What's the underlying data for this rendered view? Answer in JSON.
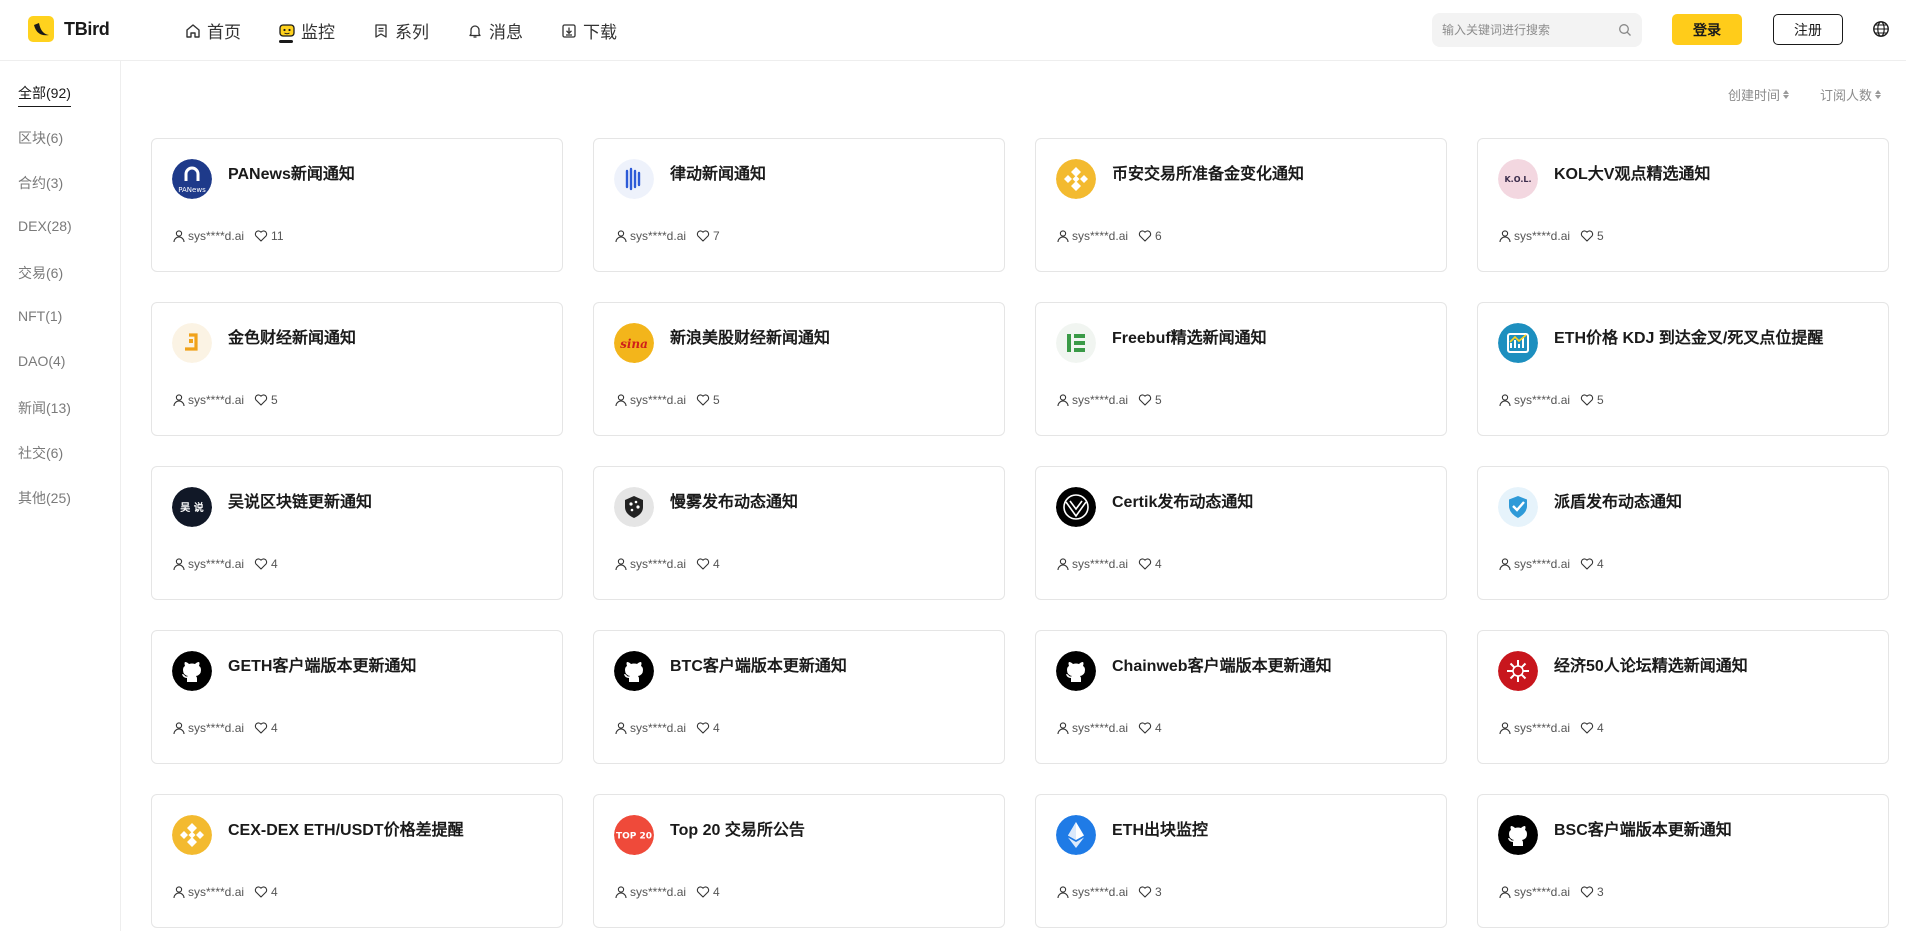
{
  "app": {
    "name": "TBird"
  },
  "nav": [
    {
      "label": "首页",
      "icon": "home-icon"
    },
    {
      "label": "监控",
      "icon": "monitor-icon",
      "active": true
    },
    {
      "label": "系列",
      "icon": "series-icon"
    },
    {
      "label": "消息",
      "icon": "bell-icon"
    },
    {
      "label": "下载",
      "icon": "download-icon"
    }
  ],
  "search": {
    "placeholder": "输入关键词进行搜索"
  },
  "auth": {
    "login": "登录",
    "register": "注册"
  },
  "categories": [
    "全部(92)",
    "区块(6)",
    "合约(3)",
    "DEX(28)",
    "交易(6)",
    "NFT(1)",
    "DAO(4)",
    "新闻(13)",
    "社交(6)",
    "其他(25)"
  ],
  "sort": {
    "created": "创建时间",
    "subscribers": "订阅人数"
  },
  "colors": {
    "accent": "#ffcc1a",
    "binance": "#f3ba2f",
    "github": "#000000"
  },
  "cards": [
    {
      "title": "PANews新闻通知",
      "author": "sys****d.ai",
      "likes": "11",
      "icon": "panews-icon",
      "icon_text": "PANews"
    },
    {
      "title": "律动新闻通知",
      "author": "sys****d.ai",
      "likes": "7",
      "icon": "blockbeats-icon"
    },
    {
      "title": "币安交易所准备金变化通知",
      "author": "sys****d.ai",
      "likes": "6",
      "icon": "binance-icon"
    },
    {
      "title": "KOL大V观点精选通知",
      "author": "sys****d.ai",
      "likes": "5",
      "icon": "kol-icon",
      "icon_text": "K.O.L."
    },
    {
      "title": "金色财经新闻通知",
      "author": "sys****d.ai",
      "likes": "5",
      "icon": "jinse-icon"
    },
    {
      "title": "新浪美股财经新闻通知",
      "author": "sys****d.ai",
      "likes": "5",
      "icon": "sina-icon",
      "icon_text": "sina"
    },
    {
      "title": "Freebuf精选新闻通知",
      "author": "sys****d.ai",
      "likes": "5",
      "icon": "freebuf-icon"
    },
    {
      "title": "ETH价格 KDJ 到达金叉/死叉点位提醒",
      "author": "sys****d.ai",
      "likes": "5",
      "icon": "chart-icon"
    },
    {
      "title": "吴说区块链更新通知",
      "author": "sys****d.ai",
      "likes": "4",
      "icon": "wushuo-icon",
      "icon_text": "吴 说"
    },
    {
      "title": "慢雾发布动态通知",
      "author": "sys****d.ai",
      "likes": "4",
      "icon": "slowmist-icon"
    },
    {
      "title": "Certik发布动态通知",
      "author": "sys****d.ai",
      "likes": "4",
      "icon": "certik-icon"
    },
    {
      "title": "派盾发布动态通知",
      "author": "sys****d.ai",
      "likes": "4",
      "icon": "peckshield-icon"
    },
    {
      "title": "GETH客户端版本更新通知",
      "author": "sys****d.ai",
      "likes": "4",
      "icon": "github-icon"
    },
    {
      "title": "BTC客户端版本更新通知",
      "author": "sys****d.ai",
      "likes": "4",
      "icon": "github-icon"
    },
    {
      "title": "Chainweb客户端版本更新通知",
      "author": "sys****d.ai",
      "likes": "4",
      "icon": "github-icon"
    },
    {
      "title": "经济50人论坛精选新闻通知",
      "author": "sys****d.ai",
      "likes": "4",
      "icon": "forum50-icon"
    },
    {
      "title": "CEX-DEX ETH/USDT价格差提醒",
      "author": "sys****d.ai",
      "likes": "4",
      "icon": "binance-icon"
    },
    {
      "title": "Top 20 交易所公告",
      "author": "sys****d.ai",
      "likes": "4",
      "icon": "top20-icon",
      "icon_text": "TOP 20"
    },
    {
      "title": "ETH出块监控",
      "author": "sys****d.ai",
      "likes": "3",
      "icon": "ethereum-icon"
    },
    {
      "title": "BSC客户端版本更新通知",
      "author": "sys****d.ai",
      "likes": "3",
      "icon": "github-icon"
    }
  ]
}
